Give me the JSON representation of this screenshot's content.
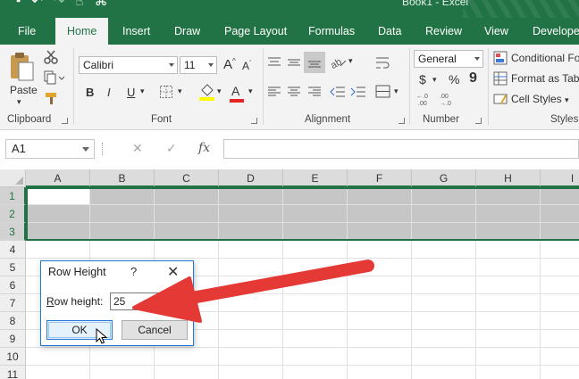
{
  "title_bar": {
    "window_title": "Book1 - Excel"
  },
  "tabs": [
    {
      "label": "File",
      "active": false
    },
    {
      "label": "Home",
      "active": true
    },
    {
      "label": "Insert",
      "active": false
    },
    {
      "label": "Draw",
      "active": false
    },
    {
      "label": "Page Layout",
      "active": false
    },
    {
      "label": "Formulas",
      "active": false
    },
    {
      "label": "Data",
      "active": false
    },
    {
      "label": "Review",
      "active": false
    },
    {
      "label": "View",
      "active": false
    },
    {
      "label": "Developer",
      "active": false
    }
  ],
  "ribbon": {
    "clipboard": {
      "label": "Clipboard",
      "paste_label": "Paste"
    },
    "font": {
      "label": "Font",
      "font_name": "Calibri",
      "font_size": "11",
      "bold": "B",
      "italic": "I",
      "underline": "U",
      "grow": "A",
      "shrink": "A",
      "font_color": "A"
    },
    "alignment": {
      "label": "Alignment"
    },
    "number": {
      "label": "Number",
      "format": "General",
      "currency": "$",
      "percent": "%",
      "comma": "9"
    },
    "styles": {
      "label": "Styles",
      "conditional": "Conditional Fo",
      "format_table": "Format as Tabl",
      "cell_styles": "Cell Styles"
    }
  },
  "formula_bar": {
    "name_box": "A1",
    "cancel": "✕",
    "enter": "✓",
    "fx": "fx",
    "value": ""
  },
  "grid": {
    "columns": [
      "A",
      "B",
      "C",
      "D",
      "E",
      "F",
      "G",
      "H",
      "I"
    ],
    "rows": [
      "1",
      "2",
      "3",
      "4",
      "5",
      "6",
      "7",
      "8",
      "9",
      "10",
      "11"
    ],
    "selected_rows": [
      1,
      2,
      3
    ],
    "active_cell": "A1"
  },
  "dialog": {
    "title": "Row Height",
    "help": "?",
    "close": "✕",
    "field_label": "Row height:",
    "field_accesskey": "R",
    "field_value": "25",
    "ok": "OK",
    "cancel": "Cancel"
  },
  "colors": {
    "excel_green": "#217346",
    "arrow_red": "#e53935",
    "dialog_border": "#1e7ad9"
  }
}
